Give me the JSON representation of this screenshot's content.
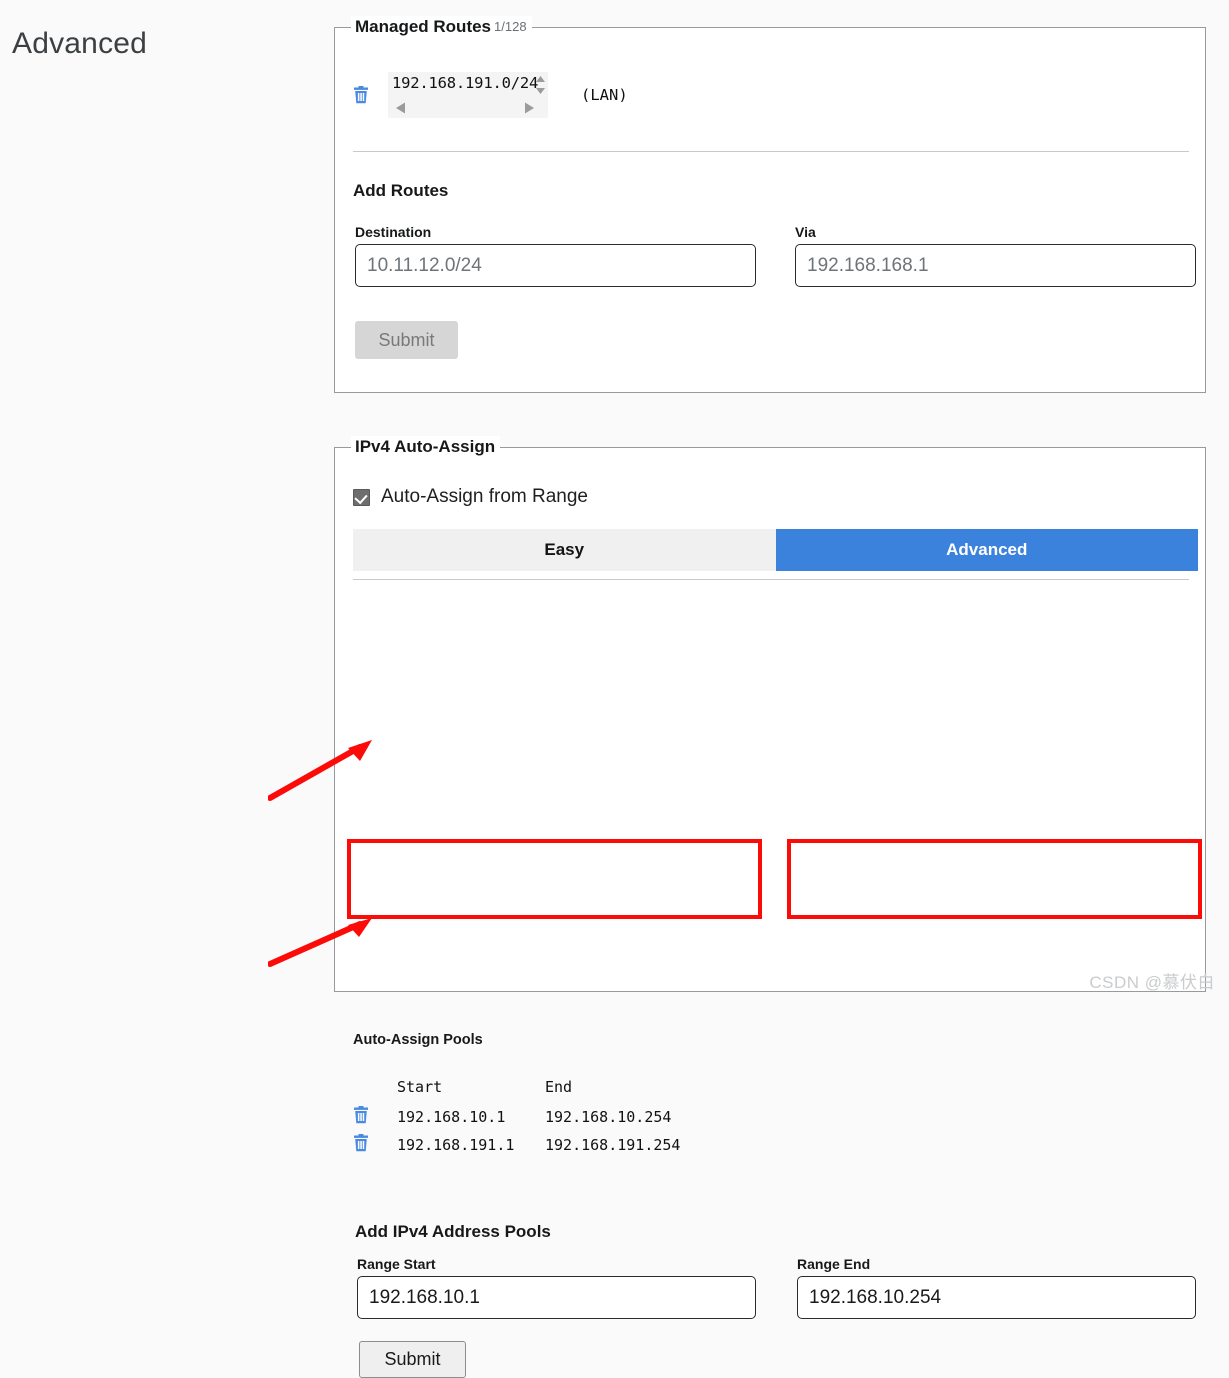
{
  "page": {
    "title": "Advanced",
    "watermark": "CSDN @慕伏白"
  },
  "managed_routes": {
    "legend": "Managed Routes",
    "count": "1/128",
    "rows": [
      {
        "delete_icon": "trash-icon",
        "value": "192.168.191.0/24",
        "annotation": "(LAN)"
      }
    ],
    "add_routes": {
      "heading": "Add Routes",
      "destination": {
        "label": "Destination",
        "value": "",
        "placeholder": "10.11.12.0/24"
      },
      "via": {
        "label": "Via",
        "value": "",
        "placeholder": "192.168.168.1"
      },
      "submit_label": "Submit",
      "submit_enabled": false
    }
  },
  "ipv4_auto_assign": {
    "legend": "IPv4 Auto-Assign",
    "checkbox": {
      "label": "Auto-Assign from Range",
      "checked": true
    },
    "tabs": [
      {
        "label": "Easy",
        "active": false
      },
      {
        "label": "Advanced",
        "active": true
      }
    ],
    "pools": {
      "heading": "Auto-Assign Pools",
      "columns": [
        "",
        "Start",
        "End"
      ],
      "rows": [
        {
          "delete_icon": "trash-icon",
          "start": "192.168.10.1",
          "end": "192.168.10.254"
        },
        {
          "delete_icon": "trash-icon",
          "start": "192.168.191.1",
          "end": "192.168.191.254"
        }
      ]
    },
    "add_pools": {
      "heading": "Add IPv4 Address Pools",
      "range_start": {
        "label": "Range Start",
        "value": "192.168.10.1",
        "placeholder": ""
      },
      "range_end": {
        "label": "Range End",
        "value": "192.168.10.254",
        "placeholder": ""
      },
      "submit_label": "Submit",
      "submit_enabled": true
    }
  },
  "colors": {
    "accent_blue": "#3b82dc",
    "trash_blue": "#4a8ae0",
    "annotation_red": "#fb0c08",
    "panel_border": "#999a9c",
    "page_bg": "#fafafa"
  }
}
